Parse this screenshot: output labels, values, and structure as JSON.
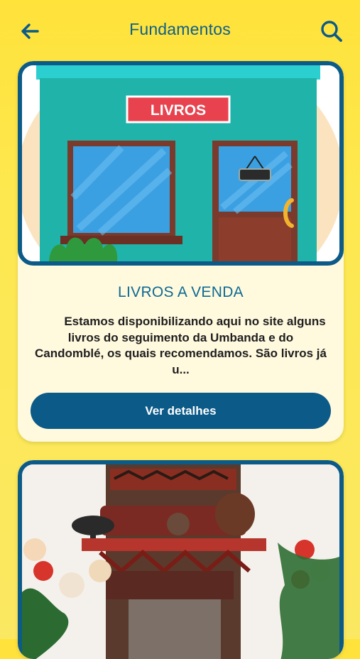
{
  "header": {
    "title": "Fundamentos",
    "back_icon": "arrow-left-icon",
    "search_icon": "search-icon"
  },
  "colors": {
    "accent": "#0b5a88",
    "title_color": "#0e5f8a",
    "background": "#ffe23a",
    "card_background": "#fff9de"
  },
  "cards": [
    {
      "image": "bookstore-illustration",
      "sign_text": "LIVROS",
      "title": "LIVROS A VENDA",
      "description": "Estamos disponibilizando aqui no site alguns livros do seguimento da Umbanda e do Candomblé, os quais recomendamos. São livros já u...",
      "button_label": "Ver detalhes"
    },
    {
      "image": "altar-photo-with-flowers"
    }
  ]
}
